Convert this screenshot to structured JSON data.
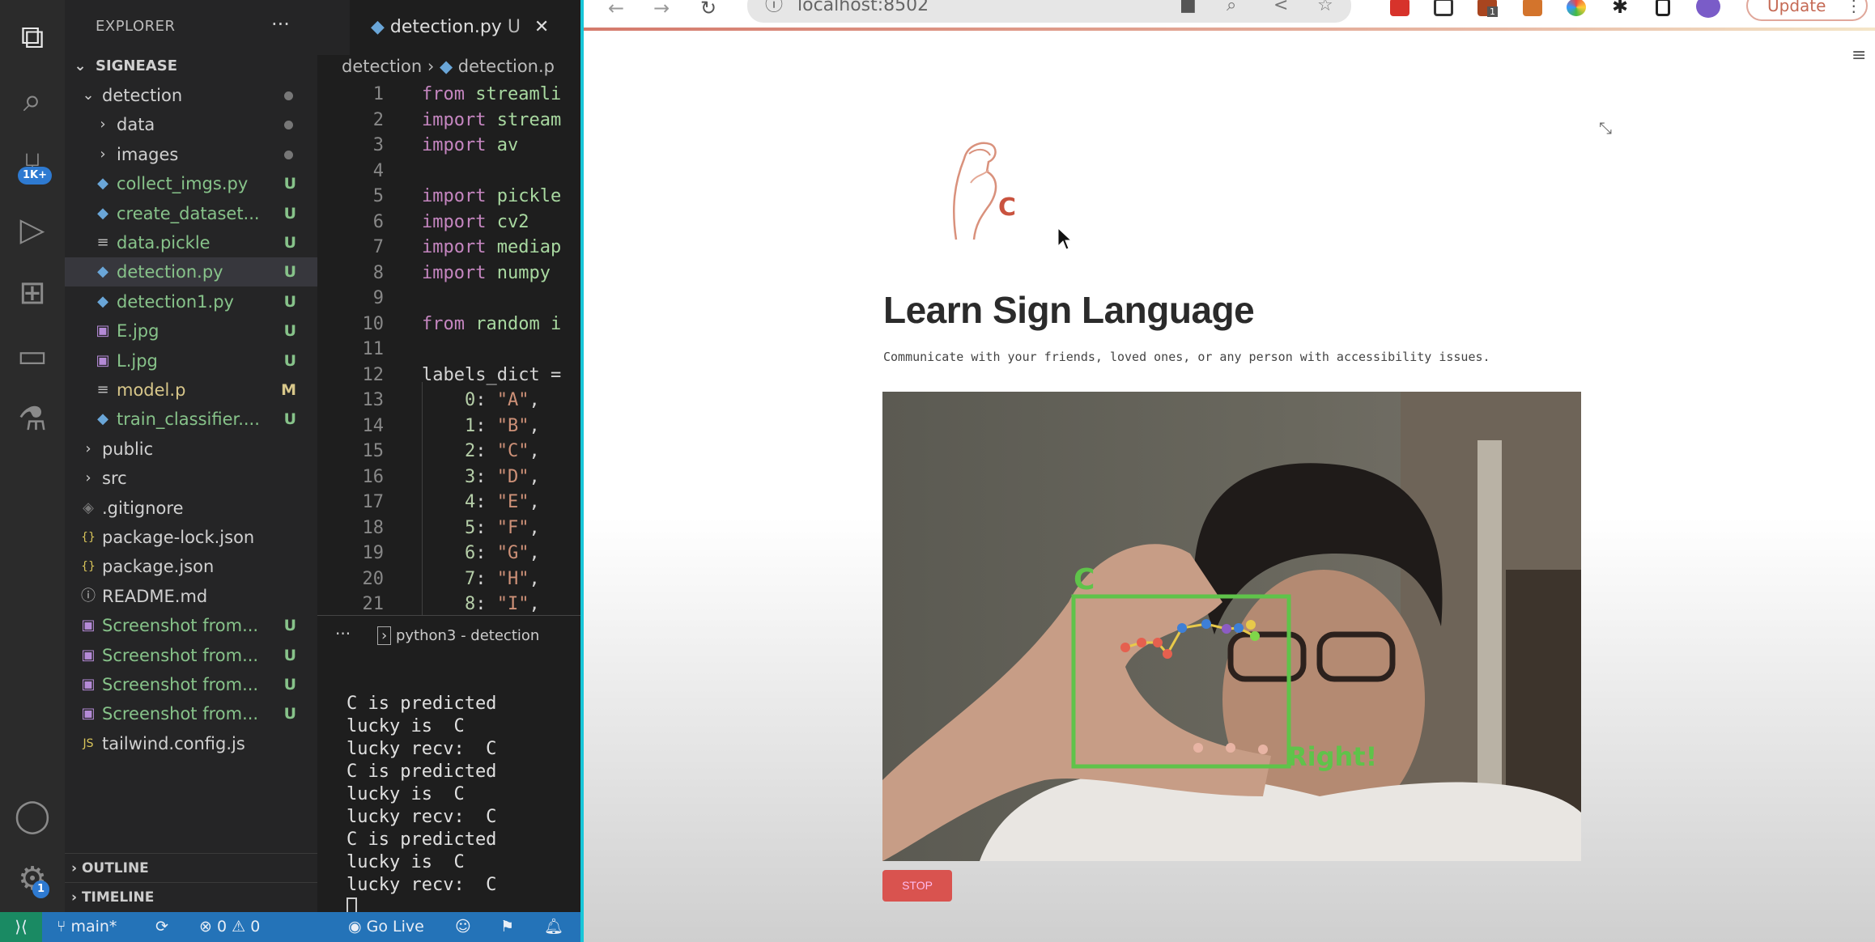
{
  "activity_bar": {
    "source_control_badge": "1K+",
    "settings_badge": "1"
  },
  "explorer": {
    "title": "EXPLORER",
    "project": "SIGNEASE",
    "items": [
      {
        "label": "detection",
        "type": "folder-open",
        "status": "dot"
      },
      {
        "label": "data",
        "type": "folder",
        "status": "dot"
      },
      {
        "label": "images",
        "type": "folder",
        "status": "dot"
      },
      {
        "label": "collect_imgs.py",
        "type": "python",
        "status": "U"
      },
      {
        "label": "create_dataset...",
        "type": "python",
        "status": "U"
      },
      {
        "label": "data.pickle",
        "type": "file",
        "status": "U"
      },
      {
        "label": "detection.py",
        "type": "python",
        "status": "U"
      },
      {
        "label": "detection1.py",
        "type": "python",
        "status": "U"
      },
      {
        "label": "E.jpg",
        "type": "image",
        "status": "U"
      },
      {
        "label": "L.jpg",
        "type": "image",
        "status": "U"
      },
      {
        "label": "model.p",
        "type": "file",
        "status": "M"
      },
      {
        "label": "train_classifier....",
        "type": "python",
        "status": "U"
      },
      {
        "label": "public",
        "type": "folder",
        "status": ""
      },
      {
        "label": "src",
        "type": "folder",
        "status": ""
      },
      {
        "label": ".gitignore",
        "type": "git",
        "status": ""
      },
      {
        "label": "package-lock.json",
        "type": "json",
        "status": ""
      },
      {
        "label": "package.json",
        "type": "json",
        "status": ""
      },
      {
        "label": "README.md",
        "type": "info",
        "status": ""
      },
      {
        "label": "Screenshot from...",
        "type": "image",
        "status": "U"
      },
      {
        "label": "Screenshot from...",
        "type": "image",
        "status": "U"
      },
      {
        "label": "Screenshot from...",
        "type": "image",
        "status": "U"
      },
      {
        "label": "Screenshot from...",
        "type": "image",
        "status": "U"
      },
      {
        "label": "tailwind.config.js",
        "type": "js",
        "status": ""
      }
    ],
    "outline": "OUTLINE",
    "timeline": "TIMELINE"
  },
  "editor": {
    "tab": "detection.py",
    "tab_status": "U",
    "breadcrumb": [
      "detection",
      "detection.p"
    ],
    "lines": [
      {
        "n": "1",
        "code": [
          [
            "kw",
            "from "
          ],
          [
            "id",
            "streamli"
          ]
        ]
      },
      {
        "n": "2",
        "code": [
          [
            "kw",
            "import "
          ],
          [
            "id",
            "stream"
          ]
        ]
      },
      {
        "n": "3",
        "code": [
          [
            "kw",
            "import "
          ],
          [
            "id",
            "av"
          ]
        ]
      },
      {
        "n": "4",
        "code": []
      },
      {
        "n": "5",
        "code": [
          [
            "kw",
            "import "
          ],
          [
            "id",
            "pickle"
          ]
        ]
      },
      {
        "n": "6",
        "code": [
          [
            "kw",
            "import "
          ],
          [
            "id",
            "cv2"
          ]
        ]
      },
      {
        "n": "7",
        "code": [
          [
            "kw",
            "import "
          ],
          [
            "id",
            "mediap"
          ]
        ]
      },
      {
        "n": "8",
        "code": [
          [
            "kw",
            "import "
          ],
          [
            "id",
            "numpy "
          ]
        ]
      },
      {
        "n": "9",
        "code": []
      },
      {
        "n": "10",
        "code": [
          [
            "kw",
            "from "
          ],
          [
            "id",
            "random i"
          ]
        ]
      },
      {
        "n": "11",
        "code": []
      },
      {
        "n": "12",
        "code": [
          [
            "",
            "labels_dict ="
          ]
        ]
      },
      {
        "n": "13",
        "code": [
          [
            "",
            "    "
          ],
          [
            "num",
            "0"
          ],
          [
            "",
            ": "
          ],
          [
            "str",
            "\"A\""
          ],
          [
            "",
            ","
          ]
        ]
      },
      {
        "n": "14",
        "code": [
          [
            "",
            "    "
          ],
          [
            "num",
            "1"
          ],
          [
            "",
            ": "
          ],
          [
            "str",
            "\"B\""
          ],
          [
            "",
            ","
          ]
        ]
      },
      {
        "n": "15",
        "code": [
          [
            "",
            "    "
          ],
          [
            "num",
            "2"
          ],
          [
            "",
            ": "
          ],
          [
            "str",
            "\"C\""
          ],
          [
            "",
            ","
          ]
        ]
      },
      {
        "n": "16",
        "code": [
          [
            "",
            "    "
          ],
          [
            "num",
            "3"
          ],
          [
            "",
            ": "
          ],
          [
            "str",
            "\"D\""
          ],
          [
            "",
            ","
          ]
        ]
      },
      {
        "n": "17",
        "code": [
          [
            "",
            "    "
          ],
          [
            "num",
            "4"
          ],
          [
            "",
            ": "
          ],
          [
            "str",
            "\"E\""
          ],
          [
            "",
            ","
          ]
        ]
      },
      {
        "n": "18",
        "code": [
          [
            "",
            "    "
          ],
          [
            "num",
            "5"
          ],
          [
            "",
            ": "
          ],
          [
            "str",
            "\"F\""
          ],
          [
            "",
            ","
          ]
        ]
      },
      {
        "n": "19",
        "code": [
          [
            "",
            "    "
          ],
          [
            "num",
            "6"
          ],
          [
            "",
            ": "
          ],
          [
            "str",
            "\"G\""
          ],
          [
            "",
            ","
          ]
        ]
      },
      {
        "n": "20",
        "code": [
          [
            "",
            "    "
          ],
          [
            "num",
            "7"
          ],
          [
            "",
            ": "
          ],
          [
            "str",
            "\"H\""
          ],
          [
            "",
            ","
          ]
        ]
      },
      {
        "n": "21",
        "code": [
          [
            "",
            "    "
          ],
          [
            "num",
            "8"
          ],
          [
            "",
            ": "
          ],
          [
            "str",
            "\"I\""
          ],
          [
            "",
            ","
          ]
        ]
      }
    ]
  },
  "terminal": {
    "tab": "python3 - detection",
    "lines": [
      "C is predicted",
      "lucky is  C",
      "lucky recv:  C",
      "C is predicted",
      "lucky is  C",
      "lucky recv:  C",
      "C is predicted",
      "lucky is  C",
      "lucky recv:  C"
    ]
  },
  "status_bar": {
    "branch": "main*",
    "errors": "0",
    "warnings": "0",
    "go_live": "Go Live"
  },
  "browser": {
    "url": "localhost:8502",
    "update_label": "Update",
    "extension_badge": "1"
  },
  "page": {
    "logo_letter": "C",
    "title": "Learn Sign Language",
    "subtitle": "Communicate with your friends, loved ones, or any person with accessibility issues.",
    "video": {
      "predicted_label": "C",
      "feedback": "Right!",
      "box_color": "#5fc34a"
    },
    "stop_label": "STOP",
    "stop_color": "#d9534f"
  }
}
